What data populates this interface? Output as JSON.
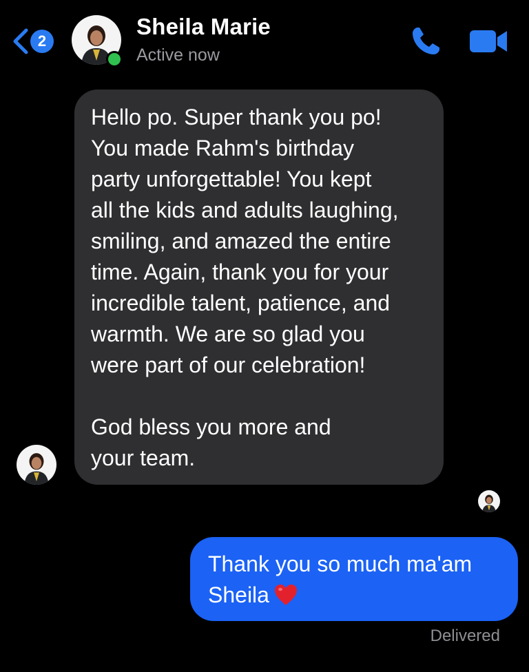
{
  "header": {
    "back_badge_count": "2",
    "contact_name": "Sheila Marie",
    "status": "Active now",
    "icons": {
      "back": "chevron-left-icon",
      "call": "phone-icon",
      "video": "video-camera-icon"
    }
  },
  "messages": [
    {
      "direction": "incoming",
      "text": "Hello po. Super thank you po!\nYou made Rahm's birthday\nparty unforgettable! You kept\nall the kids and adults laughing,\nsmiling, and amazed the entire\ntime. Again, thank you for your\nincredible talent, patience, and\nwarmth. We are so glad you\nwere part of our celebration!\n\nGod bless you more and\nyour team."
    },
    {
      "direction": "outgoing",
      "text_line1": "Thank you so much ma'am",
      "text_line2": "Sheila",
      "emoji": "red-heart"
    }
  ],
  "receipt": "Delivered",
  "colors": {
    "background": "#000000",
    "accent_blue": "#1b62f5",
    "incoming_bubble": "#2f2f31",
    "online_green": "#30c04f",
    "muted_text": "#8e8e93"
  }
}
